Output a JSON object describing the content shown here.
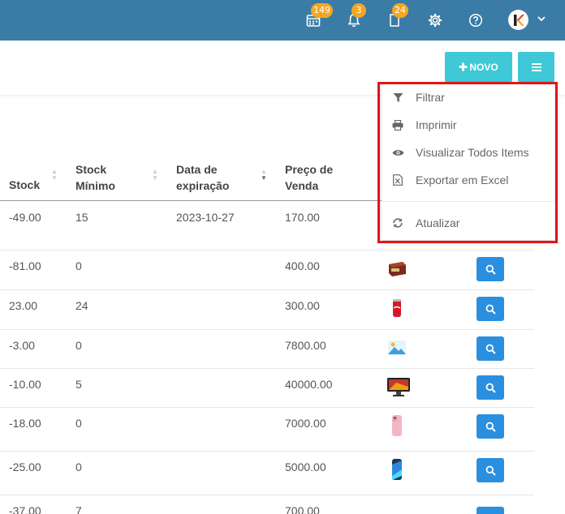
{
  "header": {
    "calendar_badge": "149",
    "notifications_badge": "3",
    "documents_badge": "24",
    "avatar_letter": "K"
  },
  "toolbar": {
    "new_label": "NOVO"
  },
  "table": {
    "columns": [
      "Stock",
      "Stock Mínimo",
      "Data de expiração",
      "Preço de Venda"
    ],
    "col_lines": [
      [
        "Stock"
      ],
      [
        "Stock",
        "Mínimo"
      ],
      [
        "Data de",
        "expiração"
      ],
      [
        "Preço de",
        "Venda"
      ]
    ],
    "rows": [
      {
        "stock": "-49.00",
        "min": "15",
        "exp": "2023-10-27",
        "price": "170.00",
        "thumb": "product-green"
      },
      {
        "stock": "-81.00",
        "min": "0",
        "exp": "",
        "price": "400.00",
        "thumb": "product-box"
      },
      {
        "stock": "23.00",
        "min": "24",
        "exp": "",
        "price": "300.00",
        "thumb": "product-can"
      },
      {
        "stock": "-3.00",
        "min": "0",
        "exp": "",
        "price": "7800.00",
        "thumb": "product-image-placeholder"
      },
      {
        "stock": "-10.00",
        "min": "5",
        "exp": "",
        "price": "40000.00",
        "thumb": "product-monitor"
      },
      {
        "stock": "-18.00",
        "min": "0",
        "exp": "",
        "price": "7000.00",
        "thumb": "product-phone-pink"
      },
      {
        "stock": "-25.00",
        "min": "0",
        "exp": "",
        "price": "5000.00",
        "thumb": "product-phone-blue"
      },
      {
        "stock": "-37.00",
        "min": "7",
        "exp": "",
        "price": "700.00",
        "thumb": "product-dark"
      }
    ]
  },
  "menu": {
    "items": [
      {
        "label": "Filtrar",
        "icon": "filter-icon"
      },
      {
        "label": "Imprimir",
        "icon": "print-icon"
      },
      {
        "label": "Visualizar Todos Items",
        "icon": "eye-icon"
      },
      {
        "label": "Exportar em Excel",
        "icon": "excel-icon"
      },
      {
        "label": "Atualizar",
        "icon": "refresh-icon"
      }
    ]
  },
  "colors": {
    "topbar": "#3a7ca5",
    "accent": "#3ec8d8",
    "search_button": "#2b8fe0",
    "badge": "#f5a623",
    "highlight": "#e0151b"
  }
}
